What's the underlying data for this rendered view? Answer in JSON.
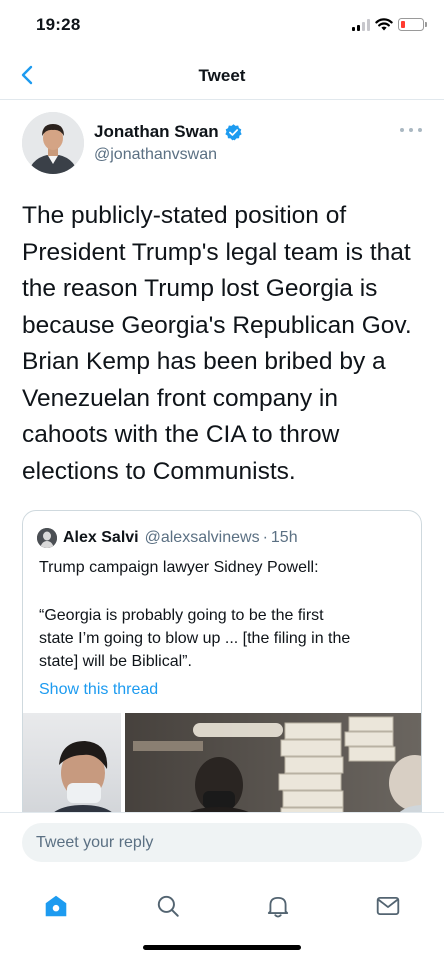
{
  "status_bar": {
    "time": "19:28"
  },
  "nav": {
    "title": "Tweet"
  },
  "tweet": {
    "author_name": "Jonathan Swan",
    "author_handle": "@jonathanvswan",
    "verified": true,
    "text_lines": [
      "The publicly-stated position of",
      "President Trump's legal team is that",
      "the reason Trump lost Georgia is",
      "because Georgia's Republican Gov.",
      "Brian Kemp has been bribed by a",
      "Venezuelan front company in",
      "cahoots with the CIA to throw",
      "elections to Communists."
    ]
  },
  "quoted_tweet": {
    "author_name": "Alex Salvi",
    "author_handle": "@alexsalvinews",
    "separator": "·",
    "time": "15h",
    "lines": [
      "Trump campaign lawyer Sidney Powell:",
      "“Georgia is probably going to be the first",
      "state I’m going to blow up ... [the filing in the",
      "state] will be Biblical”."
    ],
    "show_thread_label": "Show this thread"
  },
  "reply": {
    "placeholder": "Tweet your reply"
  },
  "tabs": [
    {
      "name": "home-icon",
      "active": true
    },
    {
      "name": "search-icon",
      "active": false
    },
    {
      "name": "bell-icon",
      "active": false
    },
    {
      "name": "mail-icon",
      "active": false
    }
  ],
  "colors": {
    "accent": "#1d9bf0",
    "text": "#0f1419",
    "secondary": "#5b7083",
    "border": "#cfd9de",
    "battery_low": "#ff3b30"
  }
}
